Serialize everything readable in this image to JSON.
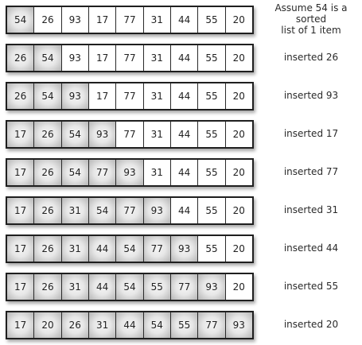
{
  "rows": [
    {
      "values": [
        "54",
        "26",
        "93",
        "17",
        "77",
        "31",
        "44",
        "55",
        "20"
      ],
      "sorted_count": 1,
      "note": "Assume 54 is a sorted\nlist of 1 item"
    },
    {
      "values": [
        "26",
        "54",
        "93",
        "17",
        "77",
        "31",
        "44",
        "55",
        "20"
      ],
      "sorted_count": 2,
      "note": "inserted 26"
    },
    {
      "values": [
        "26",
        "54",
        "93",
        "17",
        "77",
        "31",
        "44",
        "55",
        "20"
      ],
      "sorted_count": 3,
      "note": "inserted 93"
    },
    {
      "values": [
        "17",
        "26",
        "54",
        "93",
        "77",
        "31",
        "44",
        "55",
        "20"
      ],
      "sorted_count": 4,
      "note": "inserted 17"
    },
    {
      "values": [
        "17",
        "26",
        "54",
        "77",
        "93",
        "31",
        "44",
        "55",
        "20"
      ],
      "sorted_count": 5,
      "note": "inserted 77"
    },
    {
      "values": [
        "17",
        "26",
        "31",
        "54",
        "77",
        "93",
        "44",
        "55",
        "20"
      ],
      "sorted_count": 6,
      "note": "inserted 31"
    },
    {
      "values": [
        "17",
        "26",
        "31",
        "44",
        "54",
        "77",
        "93",
        "55",
        "20"
      ],
      "sorted_count": 7,
      "note": "inserted 44"
    },
    {
      "values": [
        "17",
        "26",
        "31",
        "44",
        "54",
        "55",
        "77",
        "93",
        "20"
      ],
      "sorted_count": 8,
      "note": "inserted 55"
    },
    {
      "values": [
        "17",
        "20",
        "26",
        "31",
        "44",
        "54",
        "55",
        "77",
        "93"
      ],
      "sorted_count": 9,
      "note": "inserted 20"
    }
  ]
}
